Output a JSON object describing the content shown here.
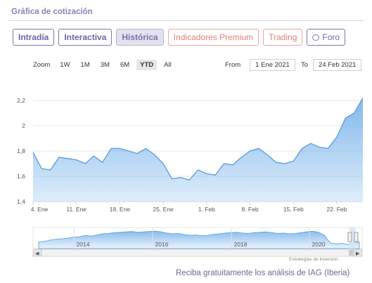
{
  "section_title": "Gráfica de cotización",
  "tabs": [
    {
      "label": "Intradía",
      "style": "normal"
    },
    {
      "label": "Interactiva",
      "style": "normal"
    },
    {
      "label": "Histórica",
      "style": "active"
    },
    {
      "label": "Indicadores Premium",
      "style": "premium"
    },
    {
      "label": "Trading",
      "style": "trading"
    },
    {
      "label": "Foro",
      "style": "foro",
      "icon": "speech-bubble-icon"
    }
  ],
  "zoom": {
    "label": "Zoom",
    "buttons": [
      "1W",
      "1M",
      "3M",
      "6M",
      "YTD",
      "All"
    ],
    "selected": "YTD"
  },
  "range": {
    "from_label": "From",
    "from_value": "1 Ene 2021",
    "to_label": "To",
    "to_value": "24 Feb 2021"
  },
  "chart_data": {
    "type": "area",
    "x": [
      "4 Ene",
      "5 Ene",
      "6 Ene",
      "7 Ene",
      "8 Ene",
      "11 Ene",
      "12 Ene",
      "13 Ene",
      "14 Ene",
      "15 Ene",
      "18 Ene",
      "19 Ene",
      "20 Ene",
      "21 Ene",
      "22 Ene",
      "25 Ene",
      "26 Ene",
      "27 Ene",
      "28 Ene",
      "29 Ene",
      "1 Feb",
      "2 Feb",
      "3 Feb",
      "4 Feb",
      "5 Feb",
      "8 Feb",
      "9 Feb",
      "10 Feb",
      "11 Feb",
      "12 Feb",
      "15 Feb",
      "16 Feb",
      "17 Feb",
      "18 Feb",
      "19 Feb",
      "22 Feb",
      "23 Feb",
      "24 Feb"
    ],
    "values": [
      1.79,
      1.66,
      1.65,
      1.75,
      1.74,
      1.73,
      1.7,
      1.76,
      1.71,
      1.82,
      1.82,
      1.8,
      1.78,
      1.82,
      1.77,
      1.7,
      1.58,
      1.59,
      1.57,
      1.65,
      1.62,
      1.61,
      1.7,
      1.69,
      1.75,
      1.8,
      1.82,
      1.77,
      1.71,
      1.7,
      1.72,
      1.82,
      1.86,
      1.83,
      1.82,
      1.91,
      2.06,
      2.1,
      2.22
    ],
    "x_tick_labels": [
      "4. Ene",
      "11. Ene",
      "18. Ene",
      "25. Ene",
      "1. Feb",
      "8. Feb",
      "15. Feb",
      "22. Feb"
    ],
    "y_tick_labels": [
      "1,4",
      "1,6",
      "1,8",
      "2",
      "2,2"
    ],
    "ylim": [
      1.4,
      2.2
    ],
    "grid": true,
    "series_color": "#7cb5ec"
  },
  "navigator": {
    "year_labels": [
      "2014",
      "2016",
      "2018",
      "2020"
    ],
    "left_arrow": "◀",
    "right_arrow": "▶"
  },
  "credit": "Estrategias de Inversión",
  "footer": "Reciba gratuitamente los análisis de IAG (Iberia)"
}
